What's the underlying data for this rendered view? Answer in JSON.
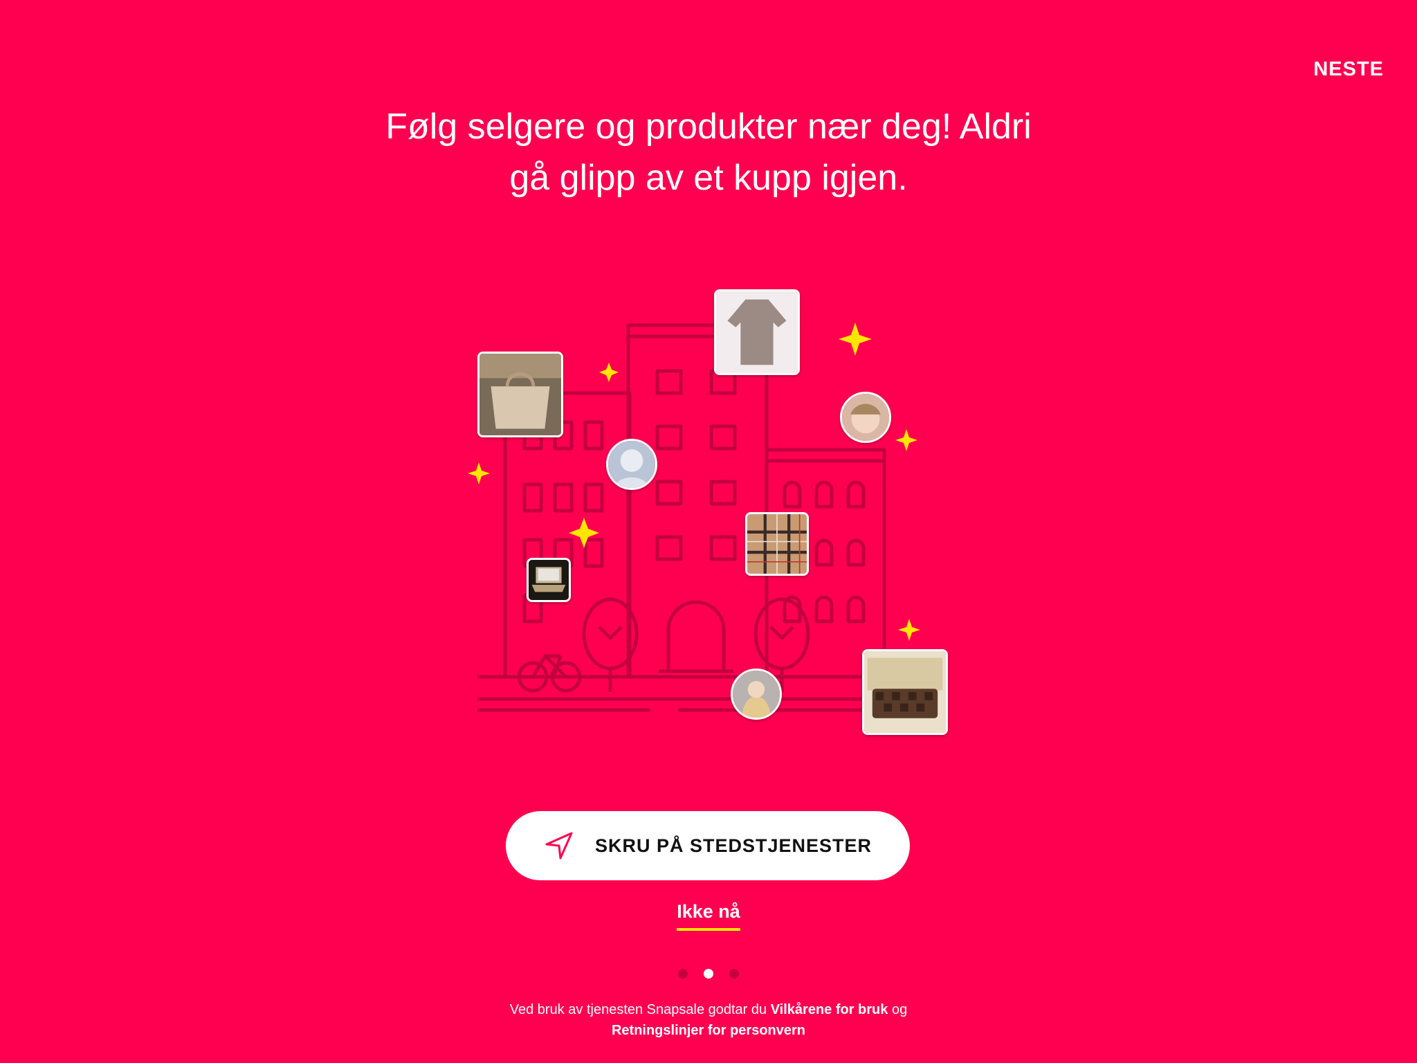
{
  "header": {
    "next_label": "NESTE"
  },
  "headline": {
    "line1": "Følg selgere og produkter nær deg! Aldri",
    "line2": "gå glipp av et kupp igjen."
  },
  "illustration": {
    "products": [
      "handbag-photo",
      "robe-photo",
      "scarf-photo",
      "laptop-photo",
      "louis-vuitton-bag-photo"
    ],
    "avatars": [
      "seller-avatar-1",
      "seller-avatar-2",
      "seller-avatar-3"
    ],
    "sparkle_color": "#ffe600"
  },
  "cta": {
    "label": "SKRU PÅ STEDSTJENESTER",
    "icon": "location-arrow-icon"
  },
  "skip": {
    "label": "Ikke nå"
  },
  "pagination": {
    "count": 3,
    "active": 2
  },
  "legal": {
    "prefix": "Ved bruk av tjenesten Snapsale godtar du ",
    "terms_link": "Vilkårene for bruk",
    "connector": " og ",
    "privacy_link": "Retningslinjer for personvern"
  },
  "colors": {
    "background": "#ff0050",
    "line_art": "#c20040",
    "accent": "#ffe600",
    "button": "#ffffff"
  }
}
